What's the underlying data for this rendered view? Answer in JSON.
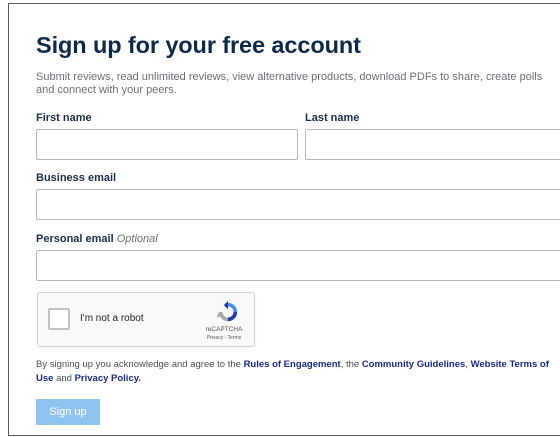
{
  "form": {
    "title": "Sign up for your free account",
    "subtitle": "Submit reviews, read unlimited reviews, view alternative products, download PDFs to share, create polls and connect with your peers.",
    "fields": {
      "first_name": {
        "label": "First name",
        "value": "",
        "placeholder": ""
      },
      "last_name": {
        "label": "Last name",
        "value": "",
        "placeholder": ""
      },
      "business_email": {
        "label": "Business email",
        "value": "",
        "placeholder": ""
      },
      "personal_email": {
        "label": "Personal email",
        "optional_tag": "Optional",
        "value": "",
        "placeholder": ""
      }
    },
    "recaptcha": {
      "label": "I'm not a robot",
      "brand": "reCAPTCHA",
      "links": "Privacy - Terms"
    },
    "legal": {
      "prefix": "By signing up you acknowledge and agree to the ",
      "rules_link": "Rules of Engagement",
      "sep1": ", the ",
      "guidelines_link": "Community Guidelines",
      "sep2": ", ",
      "terms_link": "Website Terms of Use",
      "sep3": " and ",
      "privacy_link": "Privacy Policy."
    },
    "submit_label": "Sign up"
  },
  "colors": {
    "title": "#0d2a4a",
    "link": "#1a2a8c",
    "button_disabled": "#8fc3f0",
    "recaptcha_blue": "#1c3aa9",
    "recaptcha_light_blue": "#4a90e2",
    "recaptcha_gray": "#a6a6a6"
  }
}
